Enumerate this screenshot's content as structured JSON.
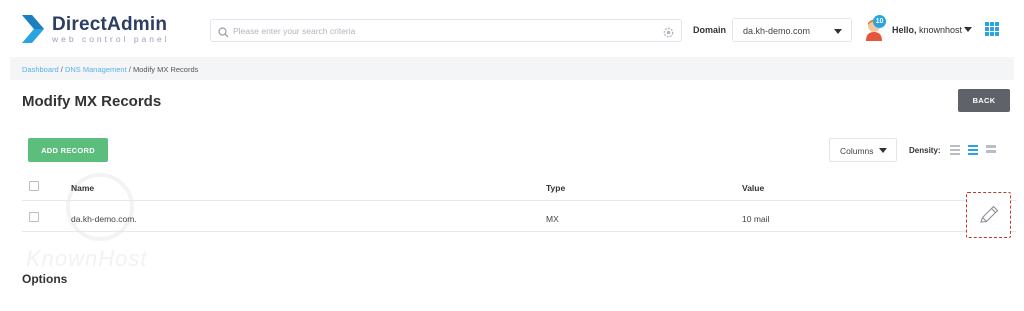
{
  "app": {
    "title": "DirectAdmin",
    "subtitle": "web control panel"
  },
  "search": {
    "placeholder": "Please enter your search criteria"
  },
  "domain": {
    "label": "Domain",
    "selected": "da.kh-demo.com"
  },
  "user": {
    "notifications": "10",
    "greeting": "Hello,",
    "username": "knownhost"
  },
  "breadcrumb": {
    "items": [
      "Dashboard",
      "DNS Management",
      "Modify MX Records"
    ]
  },
  "page": {
    "title": "Modify MX Records",
    "back_label": "BACK",
    "add_label": "ADD RECORD",
    "columns_label": "Columns",
    "density_label": "Density:",
    "options_heading": "Options"
  },
  "table": {
    "headers": [
      "Name",
      "Type",
      "Value"
    ],
    "rows": [
      {
        "name": "da.kh-demo.com.",
        "type": "MX",
        "value": "10 mail"
      }
    ]
  },
  "watermark": {
    "text": "KnownHost"
  },
  "colors": {
    "accent": "#29a4e0",
    "primary_green": "#5cbe7c",
    "back_button": "#5f6268",
    "highlight_border": "#c0392b",
    "brand_navy": "#2c3e63"
  },
  "icons": {
    "logo": "directadmin-logo-icon",
    "search": "search-icon",
    "settings": "gear-icon",
    "dropdown": "chevron-down-icon",
    "avatar": "user-avatar-icon",
    "apps": "apps-grid-icon",
    "edit": "pencil-icon"
  }
}
